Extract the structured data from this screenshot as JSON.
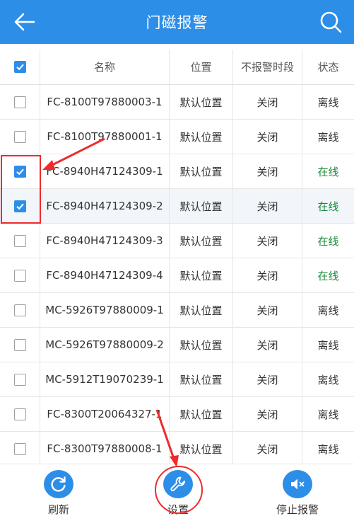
{
  "header": {
    "title": "门磁报警",
    "back_icon": "back-arrow-icon",
    "search_icon": "search-icon"
  },
  "table": {
    "columns": [
      "名称",
      "位置",
      "不报警时段",
      "状态"
    ],
    "select_all_checked": true,
    "rows": [
      {
        "name": "FC-8100T97880003-1",
        "location": "默认位置",
        "silent_period": "关闭",
        "status": "离线",
        "checked": false
      },
      {
        "name": "FC-8100T97880001-1",
        "location": "默认位置",
        "silent_period": "关闭",
        "status": "离线",
        "checked": false
      },
      {
        "name": "FC-8940H47124309-1",
        "location": "默认位置",
        "silent_period": "关闭",
        "status": "在线",
        "checked": true
      },
      {
        "name": "FC-8940H47124309-2",
        "location": "默认位置",
        "silent_period": "关闭",
        "status": "在线",
        "checked": true
      },
      {
        "name": "FC-8940H47124309-3",
        "location": "默认位置",
        "silent_period": "关闭",
        "status": "在线",
        "checked": false
      },
      {
        "name": "FC-8940H47124309-4",
        "location": "默认位置",
        "silent_period": "关闭",
        "status": "在线",
        "checked": false
      },
      {
        "name": "MC-5926T97880009-1",
        "location": "默认位置",
        "silent_period": "关闭",
        "status": "离线",
        "checked": false
      },
      {
        "name": "MC-5926T97880009-2",
        "location": "默认位置",
        "silent_period": "关闭",
        "status": "离线",
        "checked": false
      },
      {
        "name": "MC-5912T19070239-1",
        "location": "默认位置",
        "silent_period": "关闭",
        "status": "离线",
        "checked": false
      },
      {
        "name": "FC-8300T20064327-1",
        "location": "默认位置",
        "silent_period": "关闭",
        "status": "离线",
        "checked": false
      },
      {
        "name": "FC-8300T97880008-1",
        "location": "默认位置",
        "silent_period": "关闭",
        "status": "离线",
        "checked": false
      }
    ]
  },
  "toolbar": {
    "refresh_label": "刷新",
    "settings_label": "设置",
    "stop_alarm_label": "停止报警"
  },
  "colors": {
    "accent": "#2d8ee8",
    "online": "#1a8a3a",
    "annotation": "#ee2a2a"
  }
}
